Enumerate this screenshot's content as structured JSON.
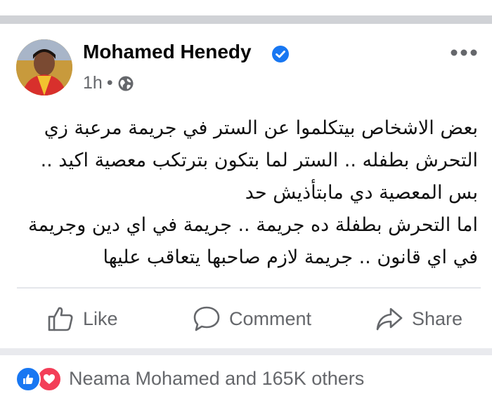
{
  "post": {
    "author": "Mohamed Henedy",
    "time": "1h",
    "separator": "•",
    "text_lines": [
      "بعض الاشخاص بيتكلموا عن الستر في جريمة مرعبة زي",
      "التحرش بطفله .. الستر لما بتكون بترتكب معصية اكيد ..",
      "بس المعصية دي مابتأذيش حد",
      "اما التحرش بطفلة ده جريمة .. جريمة في اي دين وجريمة",
      "في اي قانون .. جريمة لازم صاحبها يتعاقب عليها"
    ]
  },
  "actions": {
    "like_label": "Like",
    "comment_label": "Comment",
    "share_label": "Share"
  },
  "reactions": {
    "summary": "Neama Mohamed and 165K others",
    "icons": [
      "like-icon",
      "love-icon"
    ]
  },
  "colors": {
    "verified": "#1877f2",
    "secondary_text": "#65676b",
    "like_reaction": "#1877f2",
    "love_reaction": "#f33e58"
  }
}
